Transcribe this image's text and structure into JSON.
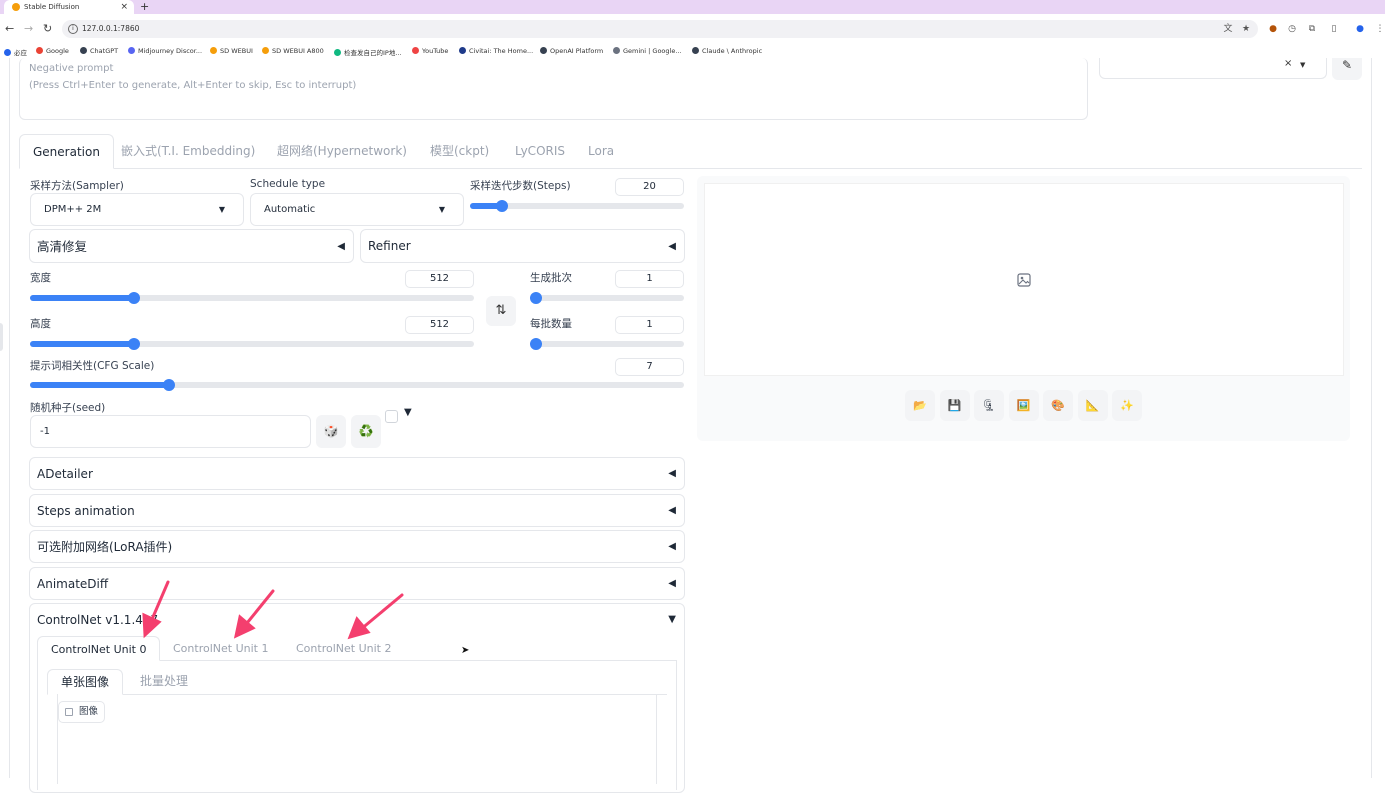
{
  "browser": {
    "tab_title": "Stable Diffusion",
    "tab_close": "×",
    "new_tab": "+",
    "url": "127.0.0.1:7860",
    "bookmarks": [
      {
        "label": "必应",
        "icon": "search-icon",
        "color": "#2563eb"
      },
      {
        "label": "Google",
        "icon": "google-icon",
        "color": "#ea4335"
      },
      {
        "label": "ChatGPT",
        "icon": "chatgpt-icon",
        "color": "#374151"
      },
      {
        "label": "Midjourney Discor...",
        "icon": "discord-icon",
        "color": "#5865f2"
      },
      {
        "label": "SD WEBUI",
        "icon": "sd-icon",
        "color": "#f59e0b"
      },
      {
        "label": "SD WEBUI A800",
        "icon": "sd-icon",
        "color": "#f59e0b"
      },
      {
        "label": "检查发自己的IP地...",
        "icon": "ip-icon",
        "color": "#10b981"
      },
      {
        "label": "YouTube",
        "icon": "youtube-icon",
        "color": "#ef4444"
      },
      {
        "label": "Civitai: The Home...",
        "icon": "civitai-icon",
        "color": "#1e3a8a"
      },
      {
        "label": "OpenAI Platform",
        "icon": "openai-icon",
        "color": "#374151"
      },
      {
        "label": "Gemini | Google...",
        "icon": "gemini-icon",
        "color": "#6b7280"
      },
      {
        "label": "Claude \\ Anthropic",
        "icon": "anthropic-icon",
        "color": "#374151"
      }
    ]
  },
  "prompt": {
    "negative_placeholder": "Negative prompt",
    "negative_hint": "(Press Ctrl+Enter to generate, Alt+Enter to skip, Esc to interrupt)",
    "style_clear": "×",
    "edit_icon": "✎"
  },
  "tabs": [
    "Generation",
    "嵌入式(T.I. Embedding)",
    "超网络(Hypernetwork)",
    "模型(ckpt)",
    "LyCORIS",
    "Lora"
  ],
  "generation": {
    "sampler_label": "采样方法(Sampler)",
    "sampler_value": "DPM++ 2M",
    "schedule_label": "Schedule type",
    "schedule_value": "Automatic",
    "steps_label": "采样迭代步数(Steps)",
    "steps_value": "20",
    "steps_fraction": 0.15,
    "hires_label": "高清修复",
    "refiner_label": "Refiner",
    "width_label": "宽度",
    "width_value": "512",
    "width_fraction": 0.235,
    "height_label": "高度",
    "height_value": "512",
    "height_fraction": 0.235,
    "batch_count_label": "生成批次",
    "batch_count_value": "1",
    "batch_size_label": "每批数量",
    "batch_size_value": "1",
    "cfg_label": "提示词相关性(CFG Scale)",
    "cfg_value": "7",
    "cfg_fraction": 0.213,
    "seed_label": "随机种子(seed)",
    "seed_value": "-1",
    "swap_icon": "⇅",
    "dice_icon": "🎲",
    "recycle_icon": "♻️",
    "extra_toggle": "▼"
  },
  "accordions": [
    {
      "label": "ADetailer",
      "state": "◀"
    },
    {
      "label": "Steps animation",
      "state": "◀"
    },
    {
      "label": "可选附加网络(LoRA插件)",
      "state": "◀"
    },
    {
      "label": "AnimateDiff",
      "state": "◀"
    },
    {
      "label": "ControlNet v1.1.417",
      "state": "▼"
    }
  ],
  "collapsed_marker": "◀",
  "controlnet": {
    "units": [
      "ControlNet Unit 0",
      "ControlNet Unit 1",
      "ControlNet Unit 2"
    ],
    "modes": [
      "单张图像",
      "批量处理"
    ],
    "image_label": "图像"
  },
  "output_tools": [
    {
      "icon": "folder-icon",
      "glyph": "📂"
    },
    {
      "icon": "save-icon",
      "glyph": "💾"
    },
    {
      "icon": "zip-icon",
      "glyph": "🗜"
    },
    {
      "icon": "send-to-img2img-icon",
      "glyph": "🖼️"
    },
    {
      "icon": "send-to-inpaint-icon",
      "glyph": "🎨"
    },
    {
      "icon": "send-to-extras-icon",
      "glyph": "📐"
    },
    {
      "icon": "sparkle-icon",
      "glyph": "✨"
    }
  ],
  "colors": {
    "accent": "#3b82f6",
    "annotation_arrow": "#f43f6e",
    "tabbar": "#e9d5f5"
  }
}
